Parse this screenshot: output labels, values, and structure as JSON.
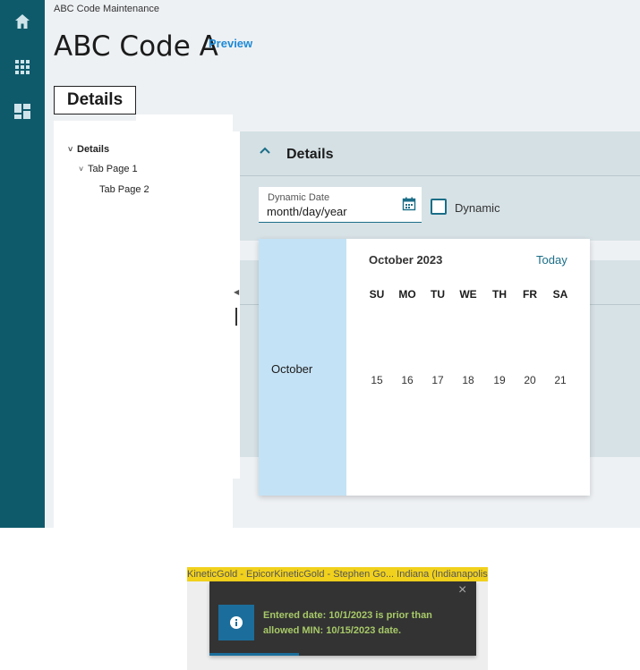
{
  "sidebar": {
    "icons": [
      "home-icon",
      "grid-icon",
      "dashboard-icon"
    ]
  },
  "breadcrumb": "ABC Code Maintenance",
  "page_title": "ABC Code A",
  "preview_link": "Preview",
  "details_tab": "Details",
  "tree": {
    "items": [
      {
        "label": "Details",
        "level": 0,
        "expanded": true
      },
      {
        "label": "Tab Page 1",
        "level": 1,
        "expanded": true
      },
      {
        "label": "Tab Page 2",
        "level": 2
      }
    ]
  },
  "details_card": {
    "title": "Details",
    "date_field": {
      "label": "Dynamic Date",
      "placeholder": "month/day/year"
    },
    "dynamic_checkbox": {
      "label": "Dynamic",
      "checked": false
    }
  },
  "date_picker": {
    "title": "October 2023",
    "today_label": "Today",
    "month": "October",
    "weekdays": [
      "SU",
      "MO",
      "TU",
      "WE",
      "TH",
      "FR",
      "SA"
    ],
    "days": [
      "15",
      "16",
      "17",
      "18",
      "19",
      "20",
      "21"
    ]
  },
  "toast": {
    "context_bar": "KineticGold - EpicorKineticGold - Stephen Go... Indiana (Indianapolis)",
    "message": "Entered date: 10/1/2023 is prior than allowed MIN: 10/15/2023 date.",
    "close_label": "×"
  },
  "colors": {
    "sidebar": "#0e5a6b",
    "accent": "#1b6e88",
    "link": "#1f8ad6",
    "month_highlight": "#c4e2f5",
    "toast_bg": "#333333",
    "toast_text": "#a7c968",
    "context_bar": "#f1d11c"
  }
}
